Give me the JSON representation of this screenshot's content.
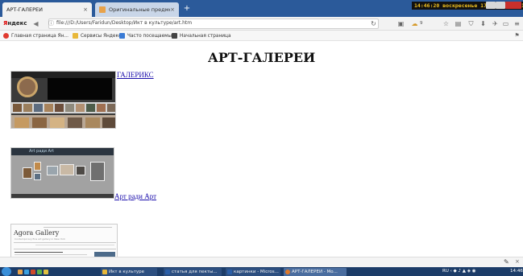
{
  "browser": {
    "tabs": [
      {
        "label": "АРТ-ГАЛЕРЕИ",
        "active": true
      },
      {
        "label": "Оригинальные предметы...",
        "active": false
      }
    ],
    "new_tab_symbol": "+",
    "tab_close_symbol": "×",
    "clock": "14:46:20 воскресенье 17 декабря 2017",
    "brand": {
      "y": "Я",
      "rest": "ндекс"
    },
    "url": "file:///D:/Users/Faridun/Desktop/Икт в культуре/art.htm",
    "counter": "9",
    "bookmarks": [
      {
        "label": "Главная страница Ян...",
        "icon": "yandex-icon",
        "color": "#e03a2f"
      },
      {
        "label": "Сервисы Яндекса",
        "icon": "folder-icon",
        "color": "#e8b83a"
      },
      {
        "label": "Часто посещаемые",
        "icon": "frequent-icon",
        "color": "#3a7bd5"
      },
      {
        "label": "Начальная страница",
        "icon": "grid-icon",
        "color": "#444444"
      }
    ]
  },
  "page": {
    "title": "АРТ-ГАЛЕРЕИ",
    "galleries": [
      {
        "link": "ГАЛЕРИКС"
      },
      {
        "link": "Арт ради Арт",
        "logo": "Art ради Art"
      },
      {
        "link": "",
        "name": "Agora Gallery",
        "subtitle": "Contemporary fine art gallery in New York"
      }
    ]
  },
  "taskbar": {
    "items": [
      {
        "label": "Икт в культуре",
        "color": "#e8b83a"
      },
      {
        "label": "статья для пекты...",
        "color": "#2b5fa8"
      },
      {
        "label": "картинки - Micros...",
        "color": "#2b5fa8"
      },
      {
        "label": "АРТ-ГАЛЕРЕИ - Мо...",
        "color": "#e07a2a",
        "active": true
      }
    ],
    "lang": "RU",
    "time": "14:46"
  }
}
